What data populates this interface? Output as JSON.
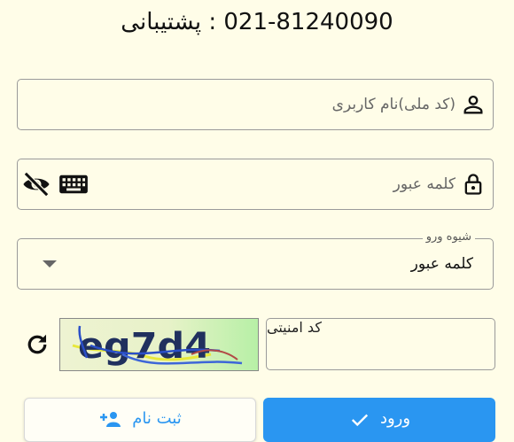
{
  "header": {
    "support_text": "021-81240090 : پشتیبانی"
  },
  "username": {
    "placeholder": "(کد ملی)نام کاربری",
    "icon": "person-icon"
  },
  "password": {
    "placeholder": "کلمه عبور",
    "icon": "lock-icon"
  },
  "login_method": {
    "legend": "شیوه ورو",
    "value": "کلمه عبور"
  },
  "captcha": {
    "placeholder": "کد امنیتی",
    "image_text": "eg7d4"
  },
  "buttons": {
    "login": "ورود",
    "register": "ثبت نام"
  },
  "colors": {
    "accent": "#2a96f1",
    "background": "#fffde8"
  }
}
